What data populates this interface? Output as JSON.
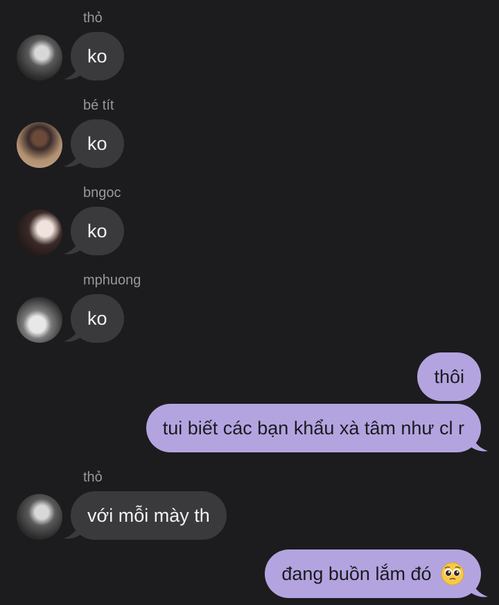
{
  "colors": {
    "background": "#1c1c1e",
    "incoming_bubble": "#3a3a3c",
    "outgoing_bubble": "#b3a4e0",
    "sender_name": "#98989d"
  },
  "messages": [
    {
      "direction": "incoming",
      "sender": "thỏ",
      "text": "ko",
      "avatar": "avatar-tho"
    },
    {
      "direction": "incoming",
      "sender": "bé tít",
      "text": "ko",
      "avatar": "avatar-be-tit"
    },
    {
      "direction": "incoming",
      "sender": "bngoc",
      "text": "ko",
      "avatar": "avatar-bngoc"
    },
    {
      "direction": "incoming",
      "sender": "mphuong",
      "text": "ko",
      "avatar": "avatar-mphuong"
    },
    {
      "direction": "outgoing",
      "text": "thôi"
    },
    {
      "direction": "outgoing",
      "text": "tui biết các bạn khẩu xà tâm như cl r"
    },
    {
      "direction": "incoming",
      "sender": "thỏ",
      "text": "với mỗi mày th",
      "avatar": "avatar-tho"
    },
    {
      "direction": "outgoing",
      "text": "đang buồn lắm đó",
      "emoji": "pleading-face-emoji"
    }
  ]
}
